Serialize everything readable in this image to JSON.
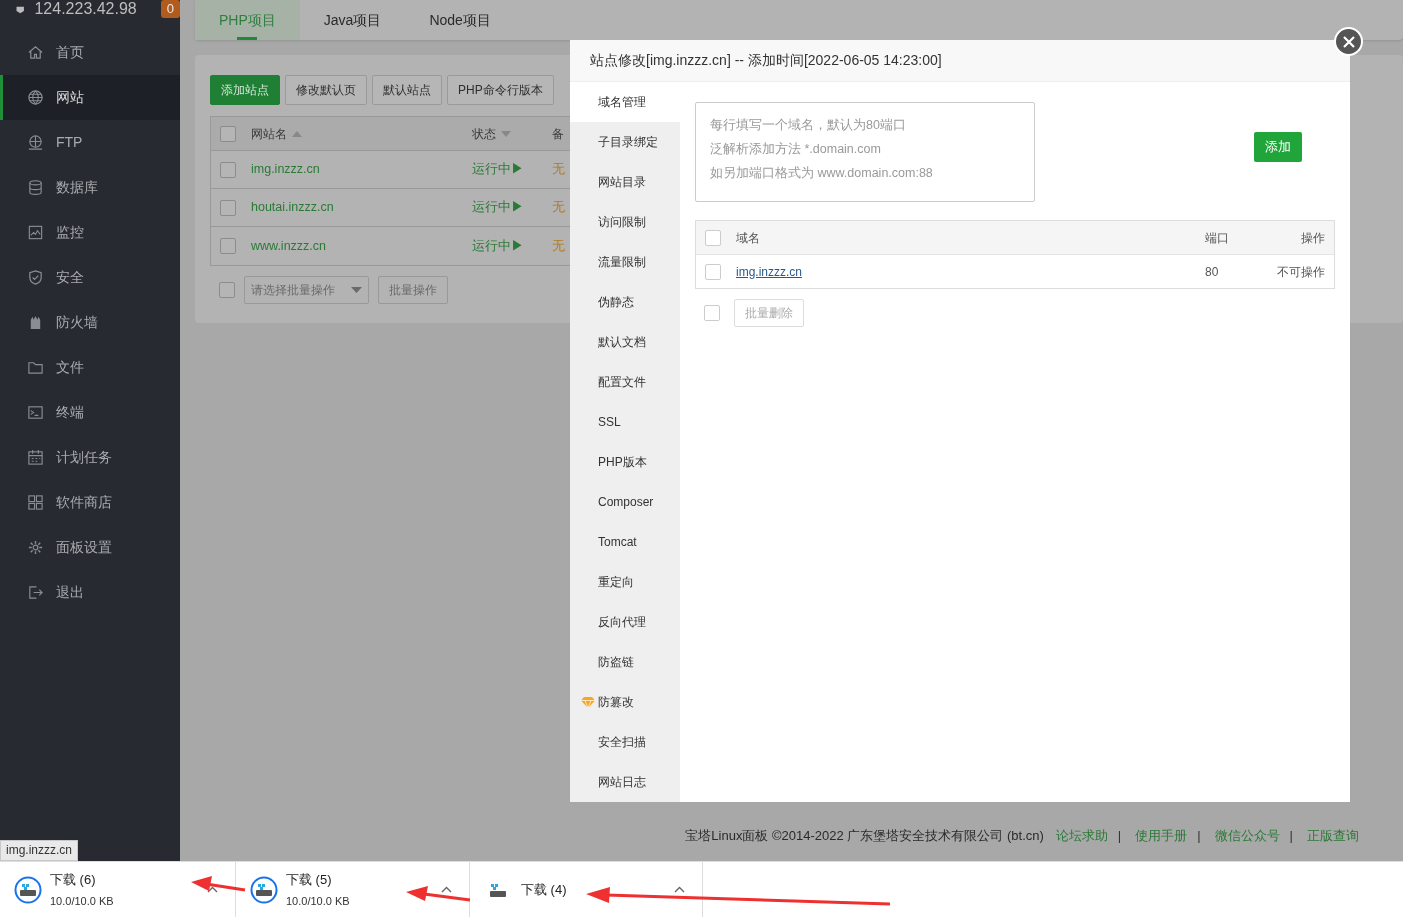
{
  "sidebar": {
    "server_ip": "124.223.42.98",
    "badge": "0",
    "items": [
      {
        "label": "首页",
        "kind": "home",
        "selected": false
      },
      {
        "label": "网站",
        "kind": "globe",
        "selected": true
      },
      {
        "label": "FTP",
        "kind": "ftp",
        "selected": false
      },
      {
        "label": "数据库",
        "kind": "database",
        "selected": false
      },
      {
        "label": "监控",
        "kind": "monitor",
        "selected": false
      },
      {
        "label": "安全",
        "kind": "shield",
        "selected": false
      },
      {
        "label": "防火墙",
        "kind": "firewall",
        "selected": false
      },
      {
        "label": "文件",
        "kind": "folder",
        "selected": false
      },
      {
        "label": "终端",
        "kind": "terminal",
        "selected": false
      },
      {
        "label": "计划任务",
        "kind": "calendar",
        "selected": false
      },
      {
        "label": "软件商店",
        "kind": "grid",
        "selected": false
      },
      {
        "label": "面板设置",
        "kind": "gear",
        "selected": false
      },
      {
        "label": "退出",
        "kind": "exit",
        "selected": false
      }
    ]
  },
  "project_tabs": [
    {
      "label": "PHP项目",
      "selected": true
    },
    {
      "label": "Java项目",
      "selected": false
    },
    {
      "label": "Node项目",
      "selected": false
    }
  ],
  "toolbar": [
    {
      "label": "添加站点",
      "kind": "primary"
    },
    {
      "label": "修改默认页",
      "kind": "plain"
    },
    {
      "label": "默认站点",
      "kind": "plain"
    },
    {
      "label": "PHP命令行版本",
      "kind": "plain"
    }
  ],
  "site_table": {
    "header_checked": false,
    "columns": [
      {
        "label": "网站名",
        "kind": "ascending"
      },
      {
        "label": "状态",
        "kind": "descending"
      },
      {
        "label": "备",
        "kind": "plain"
      }
    ],
    "rows": [
      {
        "checked": false,
        "name": "img.inzzz.cn",
        "status": "运行中▶",
        "note": "无"
      },
      {
        "checked": false,
        "name": "houtai.inzzz.cn",
        "status": "运行中▶",
        "note": "无"
      },
      {
        "checked": false,
        "name": "www.inzzz.cn",
        "status": "运行中▶",
        "note": "无"
      }
    ],
    "batch_checked": false,
    "batch_select": "请选择批量操作",
    "batch_button": "批量操作"
  },
  "dialog": {
    "title": "站点修改[img.inzzz.cn] -- 添加时间[2022-06-05 14:23:00]",
    "nav": [
      {
        "label": "域名管理",
        "selected": true,
        "premium": false
      },
      {
        "label": "子目录绑定",
        "selected": false,
        "premium": false
      },
      {
        "label": "网站目录",
        "selected": false,
        "premium": false
      },
      {
        "label": "访问限制",
        "selected": false,
        "premium": false
      },
      {
        "label": "流量限制",
        "selected": false,
        "premium": false
      },
      {
        "label": "伪静态",
        "selected": false,
        "premium": false
      },
      {
        "label": "默认文档",
        "selected": false,
        "premium": false
      },
      {
        "label": "配置文件",
        "selected": false,
        "premium": false
      },
      {
        "label": "SSL",
        "selected": false,
        "premium": false
      },
      {
        "label": "PHP版本",
        "selected": false,
        "premium": false
      },
      {
        "label": "Composer",
        "selected": false,
        "premium": false
      },
      {
        "label": "Tomcat",
        "selected": false,
        "premium": false
      },
      {
        "label": "重定向",
        "selected": false,
        "premium": false
      },
      {
        "label": "反向代理",
        "selected": false,
        "premium": false
      },
      {
        "label": "防盗链",
        "selected": false,
        "premium": false
      },
      {
        "label": "防篡改",
        "selected": false,
        "premium": true
      },
      {
        "label": "安全扫描",
        "selected": false,
        "premium": false
      },
      {
        "label": "网站日志",
        "selected": false,
        "premium": false
      }
    ],
    "domain_input": {
      "placeholder_lines": [
        "每行填写一个域名，默认为80端口",
        "泛解析添加方法 *.domain.com",
        "如另加端口格式为 www.domain.com:88"
      ]
    },
    "add_button": "添加",
    "table": {
      "header_checked": false,
      "columns": [
        "域名",
        "端口",
        "操作"
      ],
      "rows": [
        {
          "checked": false,
          "domain": "img.inzzz.cn",
          "port": "80",
          "action": "不可操作"
        }
      ]
    },
    "batch_checked": false,
    "batch_delete_button": "批量删除"
  },
  "footer": {
    "text": "宝塔Linux面板 ©2014-2022 广东堡塔安全技术有限公司 (bt.cn)",
    "links": [
      {
        "label": "论坛求助"
      },
      {
        "separator": "|",
        "label": "使用手册"
      },
      {
        "separator": "|",
        "label": "微信公众号"
      },
      {
        "separator": "|",
        "label": "正版查询"
      }
    ]
  },
  "status_url": "img.inzzz.cn",
  "downloads": [
    {
      "name": "下载 (6)",
      "size": "10.0/10.0 KB",
      "kind": "file"
    },
    {
      "name": "下载 (5)",
      "size": "10.0/10.0 KB",
      "kind": "file"
    },
    {
      "name": "下载 (4)",
      "kind": "drive"
    }
  ]
}
